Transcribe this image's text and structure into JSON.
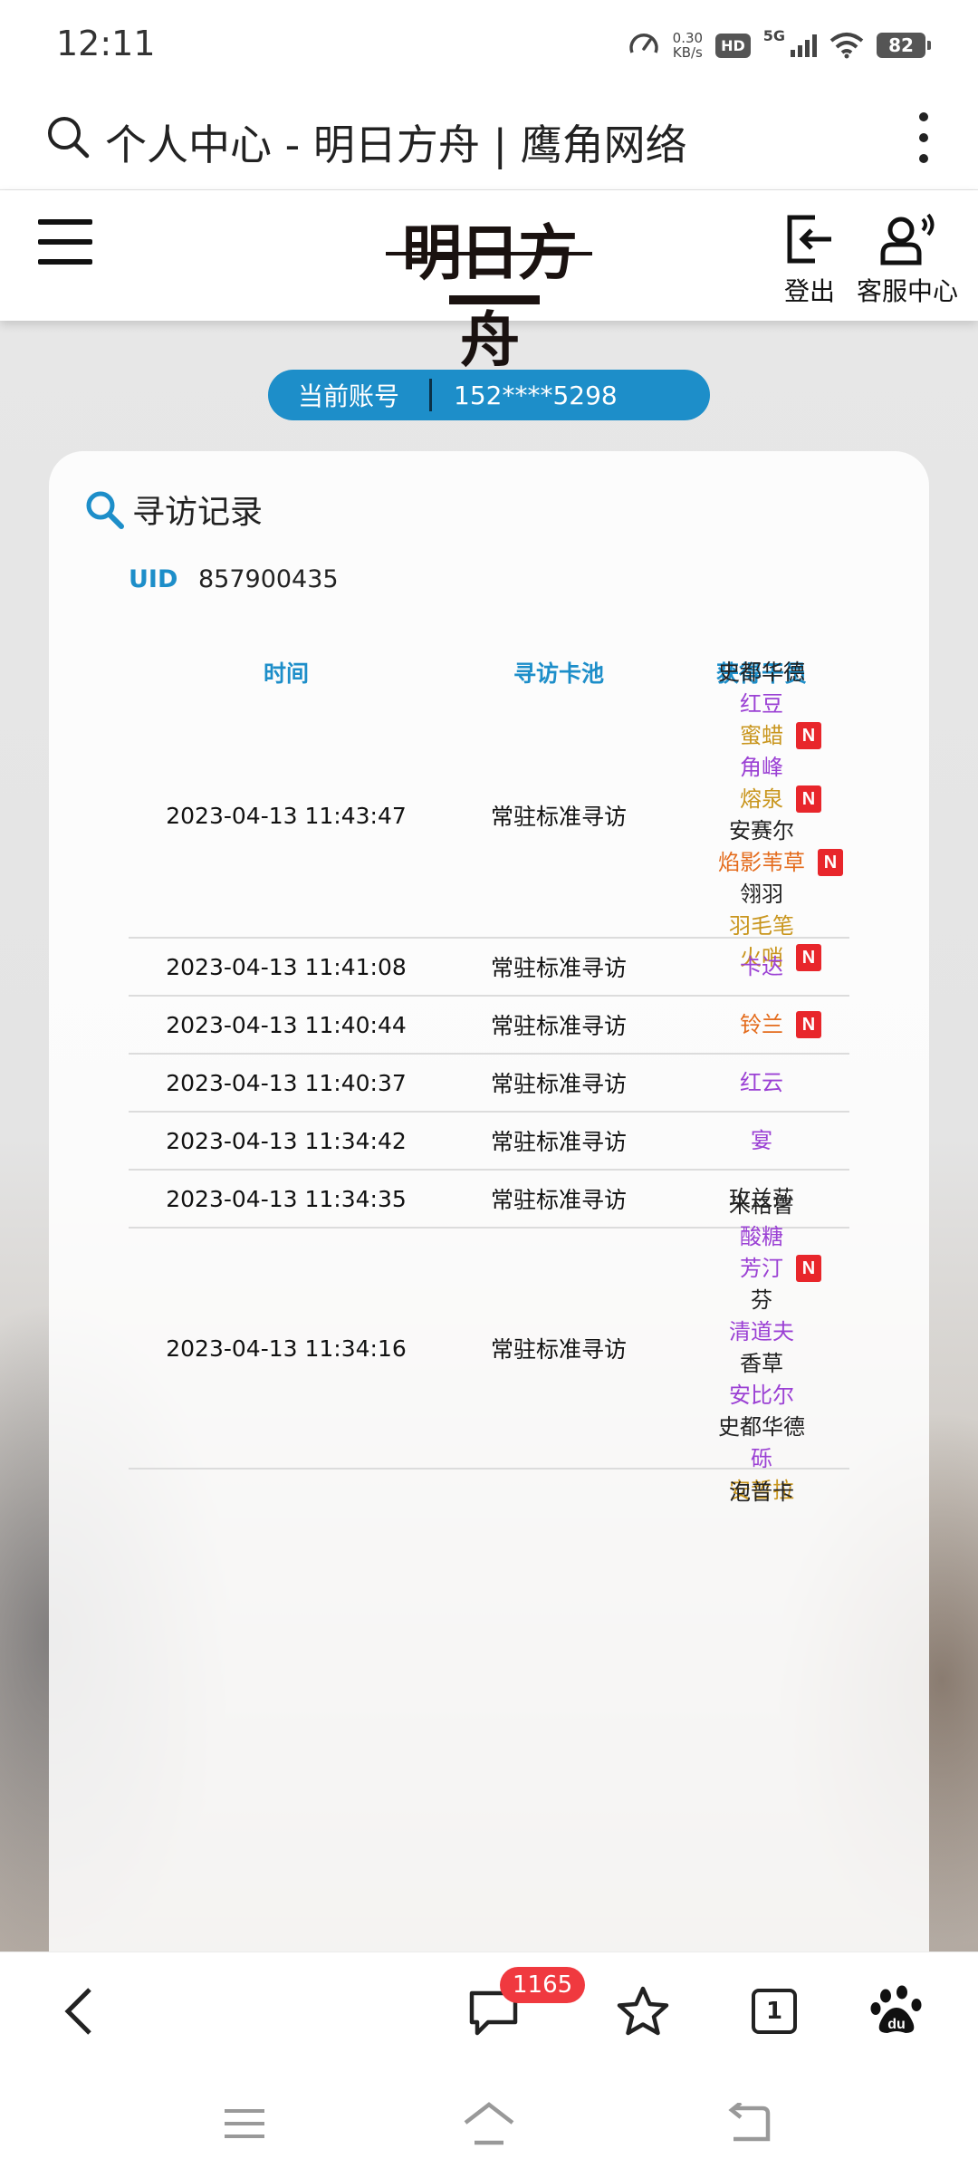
{
  "status_bar": {
    "time": "12:11",
    "net_speed_value": "0.30",
    "net_speed_unit": "KB/s",
    "hd": "HD",
    "network": "5G",
    "battery": "82"
  },
  "browser": {
    "page_title": "个人中心 - 明日方舟 | 鹰角网络"
  },
  "site_header": {
    "logo_text": "明日方舟",
    "logout_label": "登出",
    "support_label": "客服中心"
  },
  "account": {
    "label": "当前账号",
    "value": "152****5298"
  },
  "card": {
    "title": "寻访记录",
    "uid_label": "UID",
    "uid_value": "857900435",
    "columns": {
      "time": "时间",
      "pool": "寻访卡池",
      "operators": "获得干员"
    },
    "new_badge": "N",
    "rows": [
      {
        "time": "2023-04-13 11:43:47",
        "pool": "常驻标准寻访",
        "operators": [
          {
            "name": "史都华德",
            "rarity": 3,
            "new": false
          },
          {
            "name": "红豆",
            "rarity": 4,
            "new": false
          },
          {
            "name": "蜜蜡",
            "rarity": 5,
            "new": true
          },
          {
            "name": "角峰",
            "rarity": 4,
            "new": false
          },
          {
            "name": "熔泉",
            "rarity": 5,
            "new": true
          },
          {
            "name": "安赛尔",
            "rarity": 3,
            "new": false
          },
          {
            "name": "焰影苇草",
            "rarity": 6,
            "new": true
          },
          {
            "name": "翎羽",
            "rarity": 3,
            "new": false
          },
          {
            "name": "羽毛笔",
            "rarity": 5,
            "new": false
          },
          {
            "name": "火哨",
            "rarity": 5,
            "new": true
          }
        ]
      },
      {
        "time": "2023-04-13 11:41:08",
        "pool": "常驻标准寻访",
        "operators": [
          {
            "name": "卡达",
            "rarity": 4,
            "new": false
          }
        ]
      },
      {
        "time": "2023-04-13 11:40:44",
        "pool": "常驻标准寻访",
        "operators": [
          {
            "name": "铃兰",
            "rarity": 6,
            "new": true
          }
        ]
      },
      {
        "time": "2023-04-13 11:40:37",
        "pool": "常驻标准寻访",
        "operators": [
          {
            "name": "红云",
            "rarity": 4,
            "new": false
          }
        ]
      },
      {
        "time": "2023-04-13 11:34:42",
        "pool": "常驻标准寻访",
        "operators": [
          {
            "name": "宴",
            "rarity": 4,
            "new": false
          }
        ]
      },
      {
        "time": "2023-04-13 11:34:35",
        "pool": "常驻标准寻访",
        "operators": [
          {
            "name": "玫兰莎",
            "rarity": 3,
            "new": false
          }
        ]
      },
      {
        "time": "2023-04-13 11:34:16",
        "pool": "常驻标准寻访",
        "operators": [
          {
            "name": "米格鲁",
            "rarity": 3,
            "new": false
          },
          {
            "name": "酸糖",
            "rarity": 4,
            "new": false
          },
          {
            "name": "芳汀",
            "rarity": 4,
            "new": true
          },
          {
            "name": "芬",
            "rarity": 3,
            "new": false
          },
          {
            "name": "清道夫",
            "rarity": 4,
            "new": false
          },
          {
            "name": "香草",
            "rarity": 3,
            "new": false
          },
          {
            "name": "安比尔",
            "rarity": 4,
            "new": false
          },
          {
            "name": "史都华德",
            "rarity": 3,
            "new": false
          },
          {
            "name": "砾",
            "rarity": 4,
            "new": false
          },
          {
            "name": "安哲拉",
            "rarity": 5,
            "new": false
          }
        ]
      },
      {
        "time": "",
        "pool": "",
        "operators": [
          {
            "name": "泡普卡",
            "rarity": 3,
            "new": false
          }
        ]
      }
    ]
  },
  "bottom_bar": {
    "comment_count": "1165",
    "tab_count": "1"
  },
  "colors": {
    "accent": "#1d8ec9",
    "rarity_3": "#222222",
    "rarity_4": "#9b41d4",
    "rarity_5": "#c9961e",
    "rarity_6": "#e46c1d",
    "new_badge": "#e8262b"
  }
}
